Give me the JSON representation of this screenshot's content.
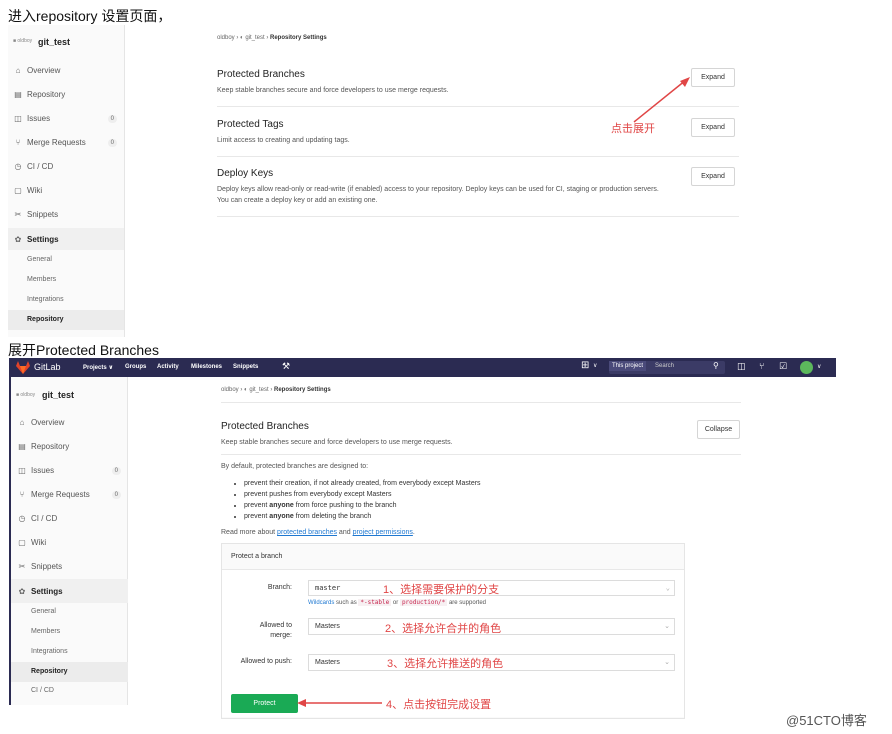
{
  "captions": {
    "top": "进入repository 设置页面，",
    "middle": "展开Protected Branches"
  },
  "top_screenshot": {
    "project_logo_text": "■ oldboy",
    "project_name": "git_test",
    "sidebar": [
      {
        "label": "Overview",
        "icon": "home-icon"
      },
      {
        "label": "Repository",
        "icon": "book-icon"
      },
      {
        "label": "Issues",
        "icon": "issues-icon",
        "badge": "0"
      },
      {
        "label": "Merge Requests",
        "icon": "merge-icon",
        "badge": "0"
      },
      {
        "label": "CI / CD",
        "icon": "rocket-icon"
      },
      {
        "label": "Wiki",
        "icon": "wiki-icon"
      },
      {
        "label": "Snippets",
        "icon": "scissors-icon"
      },
      {
        "label": "Settings",
        "icon": "gear-icon"
      }
    ],
    "settings_sub": [
      "General",
      "Members",
      "Integrations",
      "Repository"
    ],
    "breadcrumb": {
      "user": "oldboy",
      "project": "git_test",
      "page": "Repository Settings"
    },
    "sections": [
      {
        "title": "Protected Branches",
        "desc": "Keep stable branches secure and force developers to use merge requests.",
        "button": "Expand"
      },
      {
        "title": "Protected Tags",
        "desc": "Limit access to creating and updating tags.",
        "button": "Expand"
      },
      {
        "title": "Deploy Keys",
        "desc": "Deploy keys allow read-only or read-write (if enabled) access to your repository. Deploy keys can be used for CI, staging or production servers. You can create a deploy key or add an existing one.",
        "button": "Expand"
      }
    ],
    "annotation": "点击展开"
  },
  "bottom_screenshot": {
    "navbar": {
      "brand": "GitLab",
      "items": [
        "Projects ∨",
        "Groups",
        "Activity",
        "Milestones",
        "Snippets"
      ],
      "scope": "This project",
      "search_placeholder": "Search"
    },
    "project_logo_text": "■ oldboy",
    "project_name": "git_test",
    "sidebar": [
      {
        "label": "Overview",
        "icon": "home-icon"
      },
      {
        "label": "Repository",
        "icon": "book-icon"
      },
      {
        "label": "Issues",
        "icon": "issues-icon",
        "badge": "0"
      },
      {
        "label": "Merge Requests",
        "icon": "merge-icon",
        "badge": "0"
      },
      {
        "label": "CI / CD",
        "icon": "rocket-icon"
      },
      {
        "label": "Wiki",
        "icon": "wiki-icon"
      },
      {
        "label": "Snippets",
        "icon": "scissors-icon"
      },
      {
        "label": "Settings",
        "icon": "gear-icon"
      }
    ],
    "settings_sub": [
      "General",
      "Members",
      "Integrations",
      "Repository",
      "CI / CD"
    ],
    "breadcrumb": {
      "user": "oldboy",
      "project": "git_test",
      "page": "Repository Settings"
    },
    "section_title": "Protected Branches",
    "section_desc": "Keep stable branches secure and force developers to use merge requests.",
    "collapse_button": "Collapse",
    "default_text": "By default, protected branches are designed to:",
    "bullets": [
      "prevent their creation, if not already created, from everybody except Masters",
      "prevent pushes from everybody except Masters",
      "prevent anyone from force pushing to the branch",
      "prevent anyone from deleting the branch"
    ],
    "read_more": {
      "prefix": "Read more about ",
      "link1": "protected branches",
      "middle": " and ",
      "link2": "project permissions",
      "suffix": "."
    },
    "panel_title": "Protect a branch",
    "branch_label": "Branch:",
    "branch_value": "master",
    "wildcards": {
      "link": "Wildcards",
      "t1": " such as ",
      "c1": "*-stable",
      "t2": " or ",
      "c2": "production/*",
      "t3": " are supported"
    },
    "merge_label_1": "Allowed to",
    "merge_label_2": "merge:",
    "merge_value": "Masters",
    "push_label": "Allowed to push:",
    "push_value": "Masters",
    "protect_button": "Protect",
    "annotations": [
      "1、选择需要保护的分支",
      "2、选择允许合并的角色",
      "3、选择允许推送的角色",
      "4、点击按钮完成设置"
    ]
  },
  "watermark": "@51CTO博客",
  "colors": {
    "navbar": "#2b2b52",
    "annotation": "#e04646",
    "protect": "#1aaa55",
    "link": "#1f78d1"
  }
}
